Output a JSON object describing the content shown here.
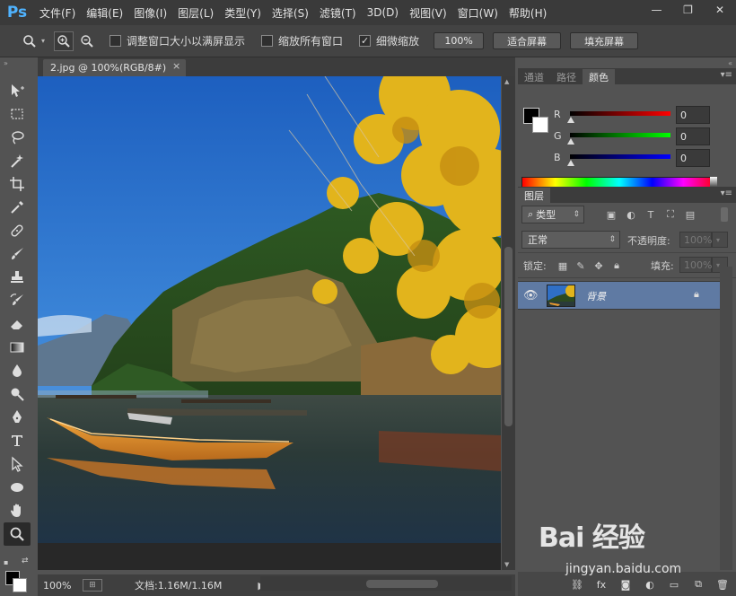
{
  "app": {
    "logo": "Ps"
  },
  "menu": [
    "文件(F)",
    "编辑(E)",
    "图像(I)",
    "图层(L)",
    "类型(Y)",
    "选择(S)",
    "滤镜(T)",
    "3D(D)",
    "视图(V)",
    "窗口(W)",
    "帮助(H)"
  ],
  "window_controls": {
    "minimize": "—",
    "maximize": "❐",
    "close": "✕"
  },
  "options": {
    "resize_windows_label": "调整窗口大小以满屏显示",
    "resize_windows_checked": false,
    "zoom_all_label": "缩放所有窗口",
    "zoom_all_checked": false,
    "scrubby_zoom_label": "细微缩放",
    "scrubby_zoom_checked": true,
    "btn_100": "100%",
    "btn_fit": "适合屏幕",
    "btn_fill": "填充屏幕"
  },
  "document": {
    "tab_title": "2.jpg @ 100%(RGB/8#)",
    "tab_close": "×",
    "zoom": "100%",
    "doc_size": "文档:1.16M/1.16M",
    "status_arrow": "▶"
  },
  "color_panel": {
    "tabs": [
      "通道",
      "路径",
      "颜色"
    ],
    "active_tab": 2,
    "r_label": "R",
    "g_label": "G",
    "b_label": "B",
    "r_value": "0",
    "g_value": "0",
    "b_value": "0",
    "fg_color": "#000000",
    "bg_color": "#ffffff"
  },
  "layers_panel": {
    "tab": "图层",
    "filter_kind": "类型",
    "blend_mode": "正常",
    "opacity_label": "不透明度:",
    "opacity_value": "100%",
    "lock_label": "锁定:",
    "fill_label": "填充:",
    "fill_value": "100%",
    "layers": [
      {
        "name": "背景",
        "visible": true,
        "locked": true
      }
    ]
  },
  "watermark": {
    "brand": "Bai 经验",
    "url": "jingyan.baidu.com"
  }
}
